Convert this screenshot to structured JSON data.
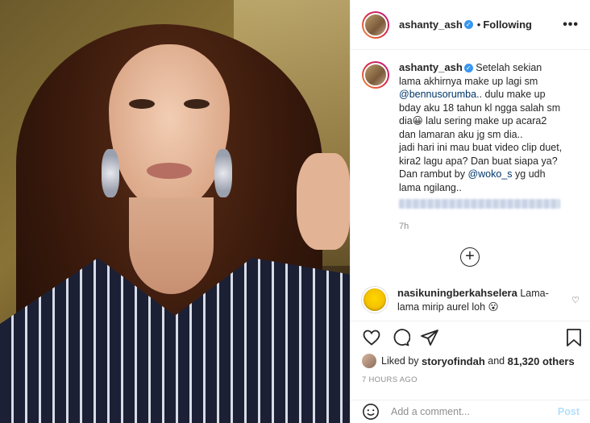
{
  "header": {
    "username": "ashanty_ash",
    "separator": "•",
    "follow_status": "Following",
    "more_icon": "more-horizontal-icon"
  },
  "caption": {
    "username": "ashanty_ash",
    "text_1": "Setelah sekian lama akhirnya make up lagi sm",
    "mention_1": "@bennusorumba",
    "text_2": ".. dulu make up bday aku 18 tahun kl ngga salah sm dia😀 lalu sering make up acara2 dan lamaran aku jg sm dia..",
    "text_3": "jadi hari ini mau buat video clip duet, kira2 lagu apa? Dan buat siapa ya?",
    "text_4": "Dan rambut by",
    "mention_2": "@woko_s",
    "text_5": "yg udh lama ngilang..",
    "time": "7h"
  },
  "load_more_icon": "plus-circle-icon",
  "comment": {
    "username": "nasikuningberkahselera",
    "text": "Lama-lama mirip aurel loh 😮"
  },
  "likes": {
    "prefix": "Liked by",
    "user": "storyofindah",
    "conj": "and",
    "count": "81,320 others"
  },
  "posted_ago": "7 HOURS AGO",
  "add_comment": {
    "placeholder": "Add a comment...",
    "post_label": "Post"
  },
  "colors": {
    "link": "#00376b",
    "verified": "#3897f0",
    "post_disabled": "#b2dffc",
    "muted": "#8e8e8e"
  }
}
